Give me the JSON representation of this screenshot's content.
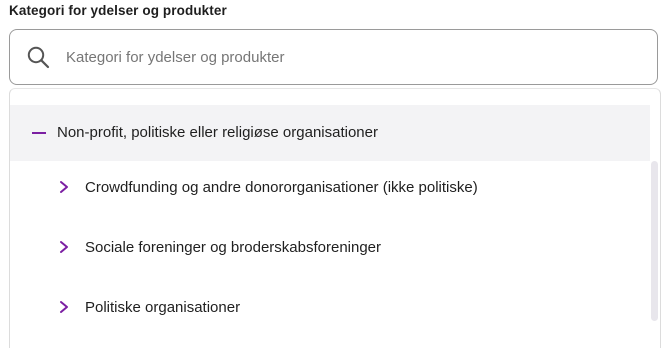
{
  "field": {
    "label": "Kategori for ydelser og produkter",
    "placeholder": "Kategori for ydelser og produkter",
    "value": ""
  },
  "colors": {
    "accent": "#7b1fa2",
    "category_row_bg": "#f3f3f5",
    "border": "#9a9a9a"
  },
  "dropdown": {
    "category": {
      "label": "Non-profit, politiske eller religiøse organisationer",
      "icon": "minus-icon",
      "expanded": true
    },
    "subcategories": [
      {
        "label": "Crowdfunding og andre donororganisationer (ikke politiske)",
        "icon": "chevron-right-icon"
      },
      {
        "label": "Sociale foreninger og broderskabsforeninger",
        "icon": "chevron-right-icon"
      },
      {
        "label": "Politiske organisationer",
        "icon": "chevron-right-icon"
      }
    ]
  }
}
